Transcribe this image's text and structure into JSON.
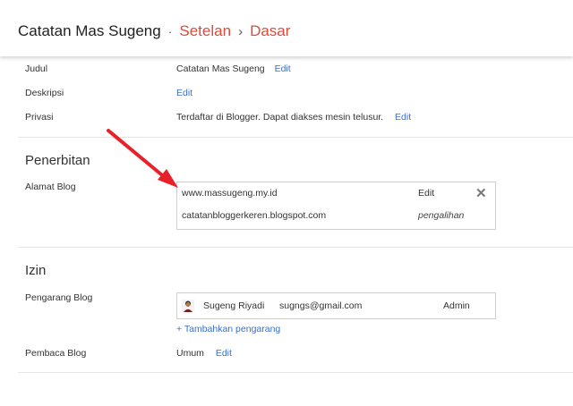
{
  "header": {
    "blog_name": "Catatan Mas Sugeng",
    "separator": "·",
    "section": "Setelan",
    "chevron": "›",
    "page": "Dasar"
  },
  "basic": {
    "title_label": "Judul",
    "title_value": "Catatan Mas Sugeng",
    "description_label": "Deskripsi",
    "privacy_label": "Privasi",
    "privacy_value": "Terdaftar di Blogger. Dapat diakses mesin telusur.",
    "edit": "Edit"
  },
  "publishing": {
    "heading": "Penerbitan",
    "address_label": "Alamat Blog",
    "custom_domain": "www.massugeng.my.id",
    "edit": "Edit",
    "close": "✕",
    "blogspot_address": "catatanbloggerkeren.blogspot.com",
    "redirect": "pengalihan"
  },
  "permissions": {
    "heading": "Izin",
    "authors_label": "Pengarang Blog",
    "author_name": "Sugeng Riyadi",
    "author_email": "sugngs@gmail.com",
    "author_role": "Admin",
    "add_author": "+ Tambahkan pengarang",
    "readers_label": "Pembaca Blog",
    "readers_value": "Umum",
    "edit": "Edit"
  },
  "colors": {
    "accent": "#dd4b39",
    "link": "#3a6fcf",
    "annotation_arrow": "#e8202a"
  }
}
